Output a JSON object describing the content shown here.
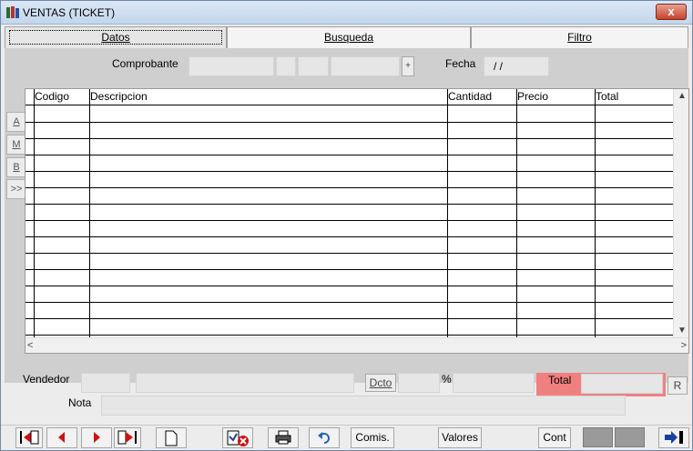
{
  "window": {
    "title": "VENTAS (TICKET)",
    "close_label": "x"
  },
  "tabs": [
    {
      "label": "Datos"
    },
    {
      "label": "Busqueda"
    },
    {
      "label": "Filtro"
    }
  ],
  "header": {
    "comprobante_label": "Comprobante",
    "plus_label": "+",
    "fecha_label": "Fecha",
    "fecha_value": "/ /"
  },
  "side_buttons": [
    "A",
    "M",
    "B",
    ">>"
  ],
  "grid": {
    "columns": [
      "Codigo",
      "Descripcion",
      "Cantidad",
      "Precio",
      "Total"
    ],
    "row_count": 15
  },
  "footer": {
    "vendedor_label": "Vendedor",
    "dcto_label": "Dcto",
    "percent_label": "%",
    "total_label": "Total",
    "r_label": "R",
    "nota_label": "Nota",
    "total_color": "#f08080"
  },
  "toolbar": {
    "comis_label": "Comis.",
    "valores_label": "Valores",
    "cont_label": "Cont"
  }
}
